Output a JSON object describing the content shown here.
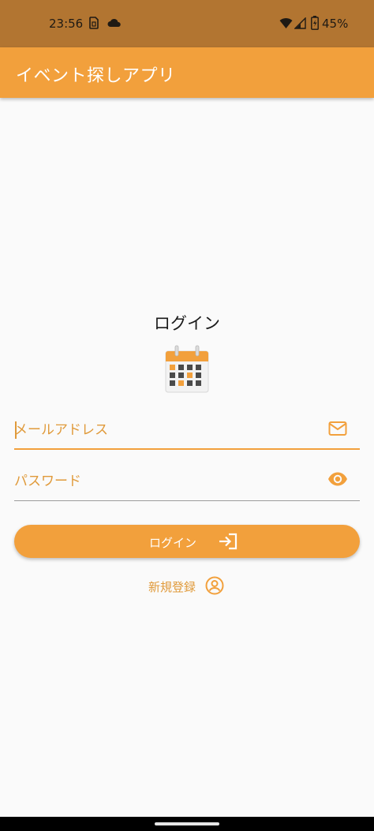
{
  "status_bar": {
    "time": "23:56",
    "battery": "45%"
  },
  "app_bar": {
    "title": "イベント探しアプリ"
  },
  "login": {
    "title": "ログイン",
    "email_placeholder": "メールアドレス",
    "password_placeholder": "パスワード",
    "login_button_label": "ログイン",
    "register_label": "新規登録"
  },
  "colors": {
    "accent": "#f2a03c",
    "status_bar": "#b27531",
    "background": "#fafafa"
  },
  "icons": {
    "email_field": "mail-icon",
    "password_field": "eye-icon",
    "login_button": "login-icon",
    "register_link": "account-circle-icon",
    "hero": "calendar-icon"
  }
}
